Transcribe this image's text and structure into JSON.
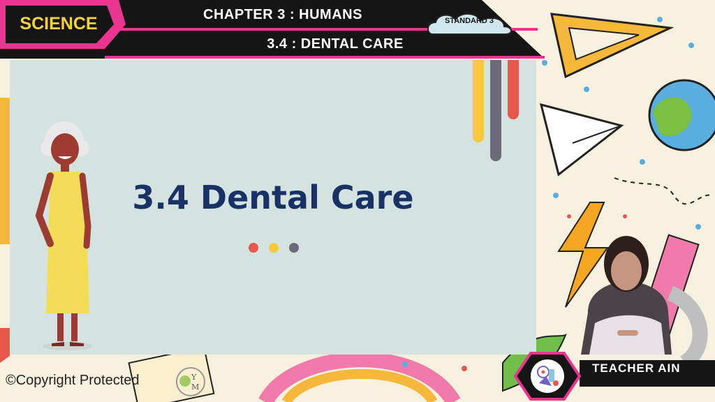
{
  "header": {
    "subject": "SCIENCE",
    "chapter": "CHAPTER 3 : HUMANS",
    "topic": "3.4 : DENTAL CARE",
    "standard": "STANDARD 3"
  },
  "slide": {
    "title": "3.4 Dental Care",
    "dot_colors": [
      "#e8574b",
      "#f5c93b",
      "#6c6a78"
    ],
    "bar_colors": [
      "#f5c93b",
      "#6c6a78",
      "#e8574b"
    ]
  },
  "presenter": {
    "name": "TEACHER AIN"
  },
  "footer": {
    "copyright": "©Copyright Protected"
  },
  "colors": {
    "accent_pink": "#e8358f",
    "title_navy": "#183266",
    "slide_bg": "#d4e3df"
  }
}
